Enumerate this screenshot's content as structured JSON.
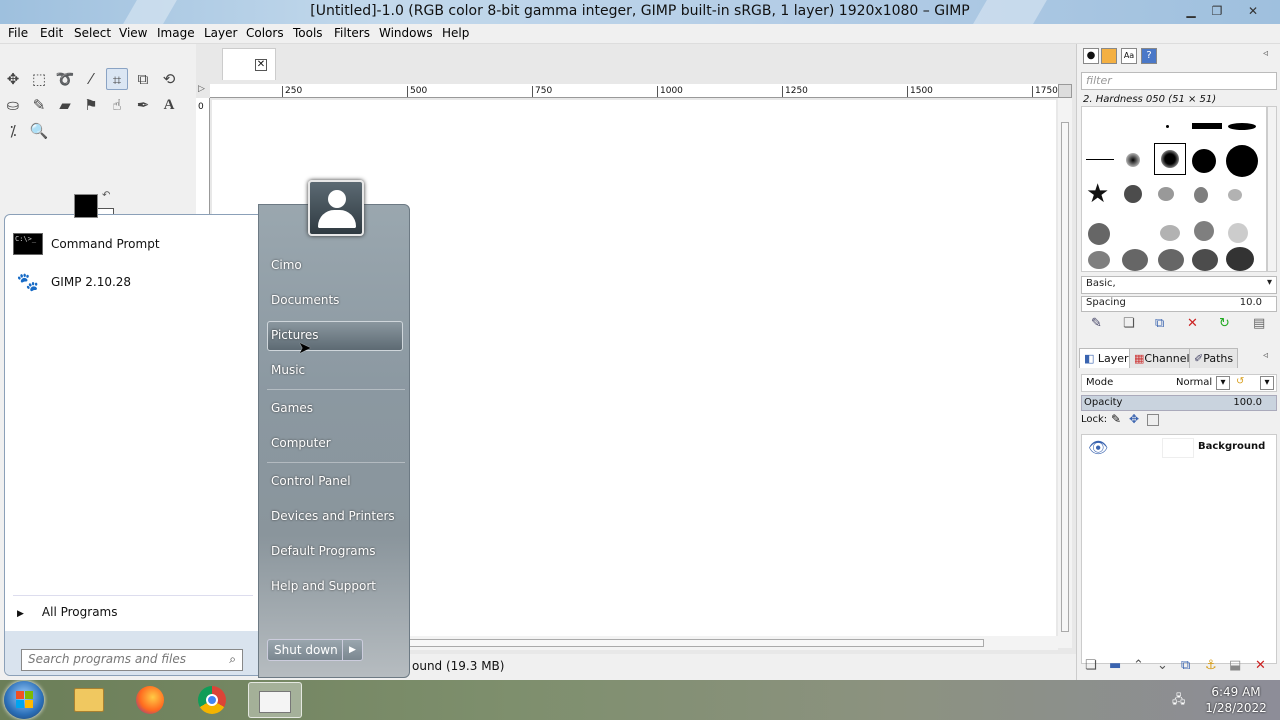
{
  "window": {
    "title": "[Untitled]-1.0 (RGB color 8-bit gamma integer, GIMP built-in sRGB, 1 layer) 1920x1080 – GIMP"
  },
  "menu": [
    "File",
    "Edit",
    "Select",
    "View",
    "Image",
    "Layer",
    "Colors",
    "Tools",
    "Filters",
    "Windows",
    "Help"
  ],
  "ruler": {
    "ticks": [
      "0",
      "250",
      "500",
      "750",
      "1000",
      "1250",
      "1500",
      "1750"
    ]
  },
  "status": {
    "text": "ound (19.3 MB)"
  },
  "brushes": {
    "filter_placeholder": "filter",
    "selected_brush": "2. Hardness 050 (51 × 51)",
    "preset": "Basic,",
    "spacing_label": "Spacing",
    "spacing_value": "10.0"
  },
  "layers_panel": {
    "tabs": [
      "Layers",
      "Channels",
      "Paths"
    ],
    "mode_label": "Mode",
    "mode_value": "Normal",
    "opacity_label": "Opacity",
    "opacity_value": "100.0",
    "lock_label": "Lock:",
    "layer_name": "Background"
  },
  "start_menu": {
    "programs": [
      "Command Prompt",
      "GIMP 2.10.28"
    ],
    "all_programs": "All Programs",
    "search_placeholder": "Search programs and files",
    "right_items": [
      "Cimo",
      "Documents",
      "Pictures",
      "Music",
      "Games",
      "Computer",
      "Control Panel",
      "Devices and Printers",
      "Default Programs",
      "Help and Support"
    ],
    "highlighted": "Pictures",
    "shutdown": "Shut down"
  },
  "clock": {
    "time": "6:49 AM",
    "date": "1/28/2022"
  },
  "colors": {
    "foreground": "#000000",
    "background": "#ffffff"
  }
}
